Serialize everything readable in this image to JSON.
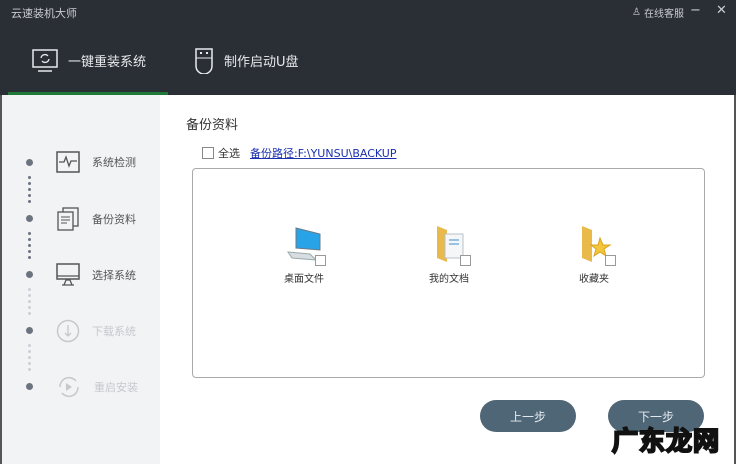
{
  "app_title": "云速装机大师",
  "support": "在线客服",
  "window": {
    "minimize": "−",
    "close": "✕"
  },
  "tabs": [
    {
      "label": "一键重装系统"
    },
    {
      "label": "制作启动U盘"
    }
  ],
  "steps": [
    {
      "label": "系统检测"
    },
    {
      "label": "备份资料"
    },
    {
      "label": "选择系统"
    },
    {
      "label": "下载系统"
    },
    {
      "label": "重启安装"
    }
  ],
  "main": {
    "title": "备份资料",
    "select_all": "全选",
    "backup_path": "备份路径:F:\\YUNSU\\BACKUP",
    "items": [
      {
        "label": "桌面文件"
      },
      {
        "label": "我的文档"
      },
      {
        "label": "收藏夹"
      }
    ]
  },
  "buttons": {
    "prev": "上一步",
    "next": "下一步"
  },
  "watermark": "广东龙网"
}
